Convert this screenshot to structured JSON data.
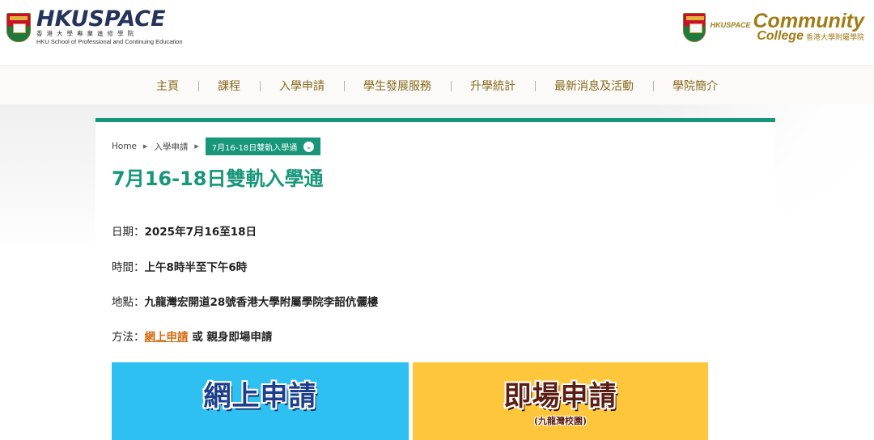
{
  "header": {
    "left_logo": {
      "wordmark": "HKUSPACE",
      "chinese": "香港大學專業進修學院",
      "english": "HKU School of Professional and Continuing Education"
    },
    "right_logo": {
      "prefix": "HKUSPACE",
      "community": "Community",
      "college": "College",
      "chinese": "香港大學附屬學院"
    }
  },
  "nav": {
    "items": [
      "主頁",
      "課程",
      "入學申請",
      "學生發展服務",
      "升學統計",
      "最新消息及活動",
      "學院簡介"
    ]
  },
  "breadcrumb": {
    "home": "Home",
    "parent": "入學申請",
    "current": "7月16-18日雙軌入學通",
    "sep_icon": "caret-right-icon",
    "chevron_icon": "chevron-down-icon"
  },
  "page": {
    "title": "7月16-18日雙軌入學通",
    "date_label": "日期：",
    "date_value": "2025年7月16至18日",
    "time_label": "時間：",
    "time_value": "上午8時半至下午6時",
    "venue_label": "地點：",
    "venue_value": "九龍灣宏開道28號香港大學附屬學院李韶伉儷樓",
    "method_label": "方法：",
    "method_link": "網上申請",
    "method_rest": " 或 親身即場申請"
  },
  "banners": {
    "online_title": "網上申請",
    "onsite_title": "即場申請",
    "onsite_sub": "(九龍灣校園)"
  },
  "colors": {
    "accent_green": "#17967a",
    "nav_gold": "#8a6b1f",
    "link_orange": "#d46a10",
    "banner_blue": "#2fc0f2",
    "banner_yellow": "#fec63a"
  }
}
